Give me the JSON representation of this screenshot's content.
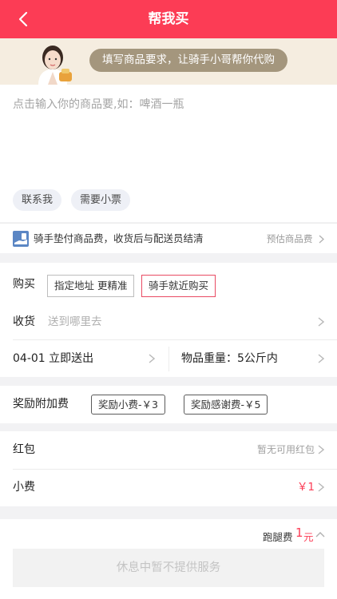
{
  "header": {
    "title": "帮我买"
  },
  "banner": {
    "text": "填写商品要求，让骑手小哥帮你代购"
  },
  "request": {
    "placeholder": "点击输入你的商品要,如：啤酒一瓶",
    "chips": [
      "联系我",
      "需要小票"
    ]
  },
  "notice": {
    "text": "骑手垫付商品费，收货后与配送员结清",
    "estimate": "预估商品费"
  },
  "purchase": {
    "label": "购买",
    "options": [
      "指定地址 更精准",
      "骑手就近购买"
    ],
    "selected_index": 1
  },
  "delivery": {
    "label": "收货",
    "placeholder": "送到哪里去"
  },
  "schedule": {
    "time": "04-01 立即送出",
    "weight": "物品重量：5公斤内"
  },
  "bonus": {
    "label": "奖励附加费",
    "tags": [
      "奖励小费-￥3",
      "奖励感谢费-￥5"
    ]
  },
  "redpacket": {
    "label": "红包",
    "value": "暂无可用红包"
  },
  "tip": {
    "label": "小费",
    "value": "￥1"
  },
  "footer": {
    "fee_label": "跑腿费",
    "fee_value": "1",
    "fee_unit": "元",
    "submit": "休息中暂不提供服务"
  },
  "colors": {
    "brand": "#fc3c55",
    "banner_bg": "#f5ede0",
    "bubble": "#a4967d",
    "selected_border": "#e94b63"
  },
  "icons": [
    "back-arrow-icon",
    "rider-avatar",
    "hand-coin-icon",
    "chevron-right-icon",
    "chevron-up-icon"
  ]
}
